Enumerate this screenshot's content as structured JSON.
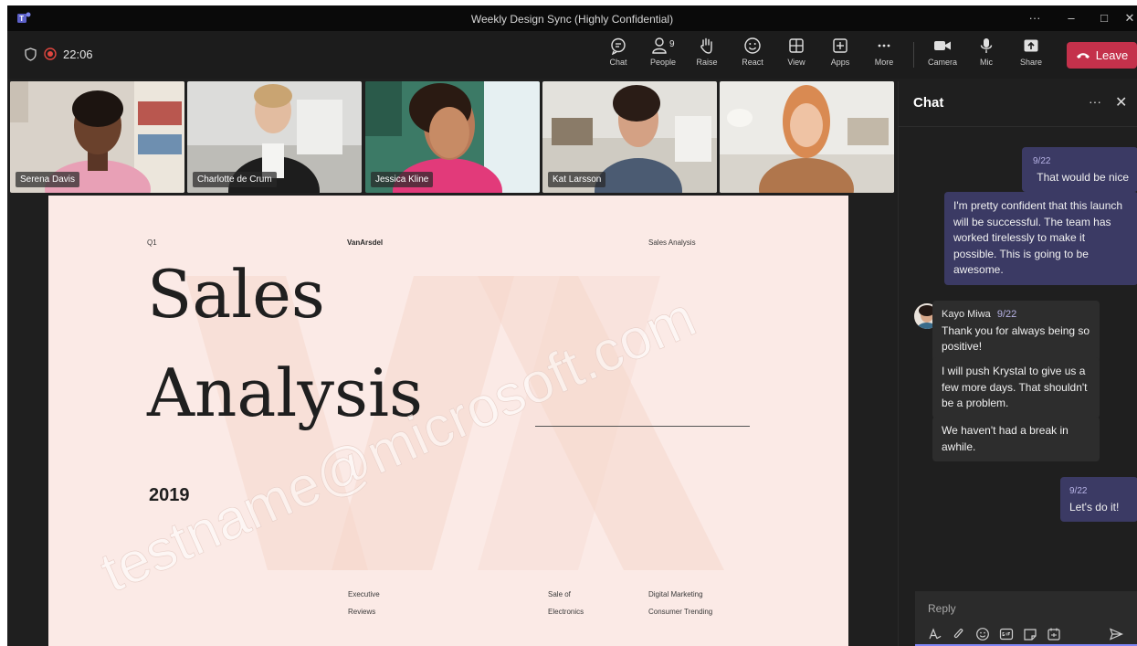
{
  "window": {
    "title": "Weekly Design Sync (Highly Confidential)",
    "more": "···",
    "minimize": "–",
    "maximize": "□",
    "close": "✕"
  },
  "meeting": {
    "timer": "22:06"
  },
  "toolbar": {
    "chat": "Chat",
    "people": "People",
    "people_count": "9",
    "raise": "Raise",
    "react": "React",
    "view": "View",
    "apps": "Apps",
    "more": "More",
    "camera": "Camera",
    "mic": "Mic",
    "share": "Share",
    "leave": "Leave"
  },
  "participants": [
    {
      "name": "Serena Davis"
    },
    {
      "name": "Charlotte de Crum"
    },
    {
      "name": "Jessica Kline"
    },
    {
      "name": "Kat Larsson"
    },
    {
      "name": ""
    }
  ],
  "slide": {
    "quarter": "Q1",
    "brand": "VanArsdel",
    "header_right": "Sales Analysis",
    "title_line1": "Sales",
    "title_line2": "Analysis",
    "year": "2019",
    "col1_a": "Executive",
    "col1_b": "Reviews",
    "col2_a": "Sale of",
    "col2_b": "Electronics",
    "col3_a": "Digital Marketing",
    "col3_b": "Consumer Trending",
    "watermark": "testname@microsoft.com"
  },
  "chat": {
    "title": "Chat",
    "more": "···",
    "close": "✕",
    "messages": [
      {
        "time": "9/22",
        "text": "That would be nice"
      },
      {
        "text": "I'm pretty confident that this launch will be successful. The team has worked tirelessly to make it possible. This is going to be awesome."
      },
      {
        "sender": "Kayo Miwa",
        "time": "9/22",
        "text": "Thank you for always being so positive!"
      },
      {
        "text": "I will push Krystal to give us a few more days. That shouldn't be a problem."
      },
      {
        "text": "We haven't had a break in awhile."
      },
      {
        "time": "9/22",
        "text": "Let's do it!"
      }
    ],
    "reply_placeholder": "Reply"
  },
  "colors": {
    "accent": "#7f85f5",
    "leave": "#c4314b",
    "my_bubble": "#3b3a64",
    "recording": "#e0463f"
  }
}
